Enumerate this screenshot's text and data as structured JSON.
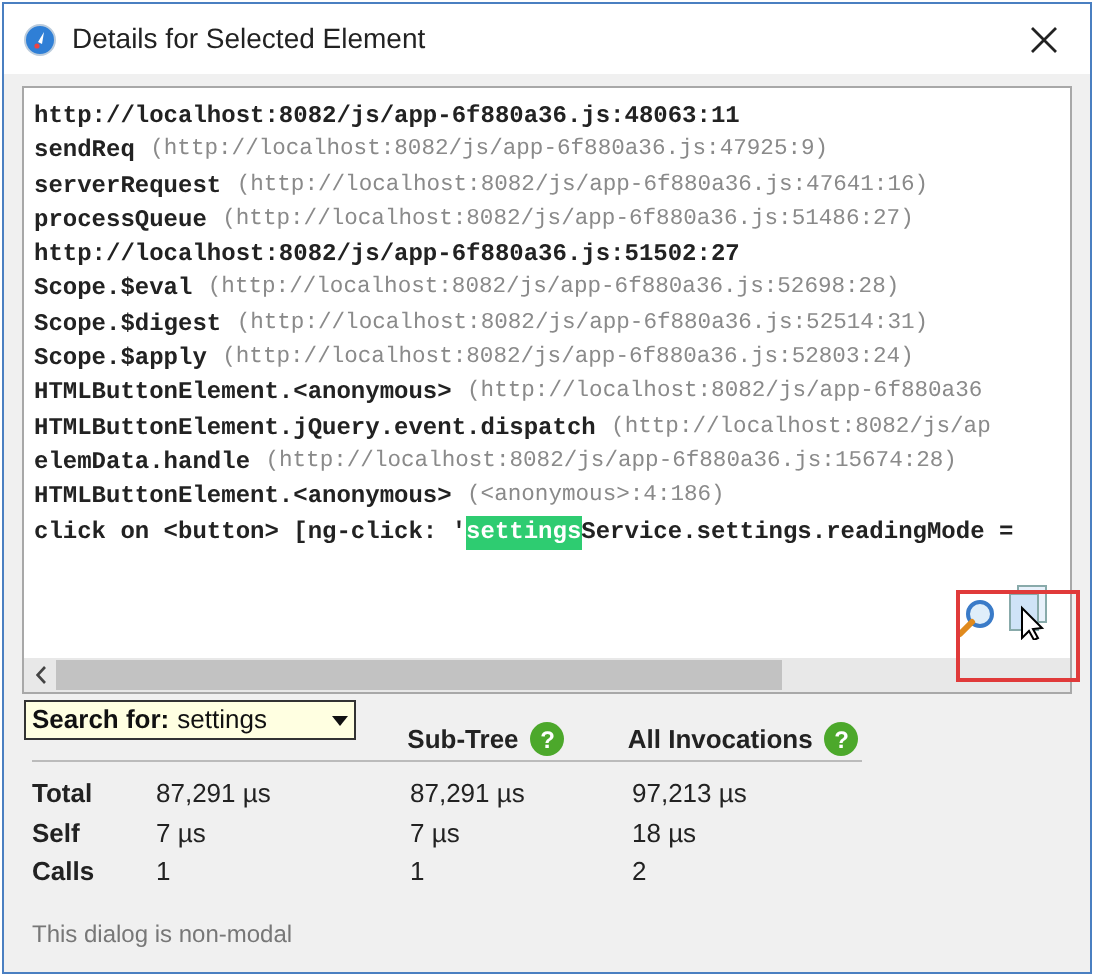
{
  "window": {
    "title": "Details for Selected Element"
  },
  "stack_lines": [
    {
      "kind": "url",
      "name": "http://localhost:8082/js/app-6f880a36.js:48063:11"
    },
    {
      "kind": "call",
      "name": "sendReq",
      "location": "(http://localhost:8082/js/app-6f880a36.js:47925:9)"
    },
    {
      "kind": "call",
      "name": "serverRequest",
      "location": "(http://localhost:8082/js/app-6f880a36.js:47641:16)"
    },
    {
      "kind": "call",
      "name": "processQueue",
      "location": "(http://localhost:8082/js/app-6f880a36.js:51486:27)"
    },
    {
      "kind": "url",
      "name": "http://localhost:8082/js/app-6f880a36.js:51502:27"
    },
    {
      "kind": "call",
      "name": "Scope.$eval",
      "location": "(http://localhost:8082/js/app-6f880a36.js:52698:28)"
    },
    {
      "kind": "call",
      "name": "Scope.$digest",
      "location": "(http://localhost:8082/js/app-6f880a36.js:52514:31)"
    },
    {
      "kind": "call",
      "name": "Scope.$apply",
      "location": "(http://localhost:8082/js/app-6f880a36.js:52803:24)"
    },
    {
      "kind": "call",
      "name": "HTMLButtonElement.<anonymous>",
      "location": "(http://localhost:8082/js/app-6f880a36"
    },
    {
      "kind": "call",
      "name": "HTMLButtonElement.jQuery.event.dispatch",
      "location": "(http://localhost:8082/js/ap"
    },
    {
      "kind": "call",
      "name": "elemData.handle",
      "location": "(http://localhost:8082/js/app-6f880a36.js:15674:28)"
    },
    {
      "kind": "call",
      "name": "HTMLButtonElement.<anonymous>",
      "location": "(<anonymous>:4:186)"
    },
    {
      "kind": "match",
      "before": "click on <button> [ng-click: '",
      "match": "settings",
      "after": "Service.settings.readingMode ="
    }
  ],
  "search": {
    "label": "Search for:",
    "value": "settings"
  },
  "table": {
    "columns": [
      {
        "label": "Sub-Tree",
        "help": "?"
      },
      {
        "label": "All Invocations",
        "help": "?"
      }
    ],
    "rows": [
      {
        "label": "Total",
        "values": [
          "87,291 µs",
          "87,291 µs",
          "97,213 µs"
        ]
      },
      {
        "label": "Self",
        "values": [
          "7 µs",
          "7 µs",
          "18 µs"
        ]
      },
      {
        "label": "Calls",
        "values": [
          "1",
          "1",
          "2"
        ]
      }
    ]
  },
  "status_bar": "This dialog is non-modal"
}
